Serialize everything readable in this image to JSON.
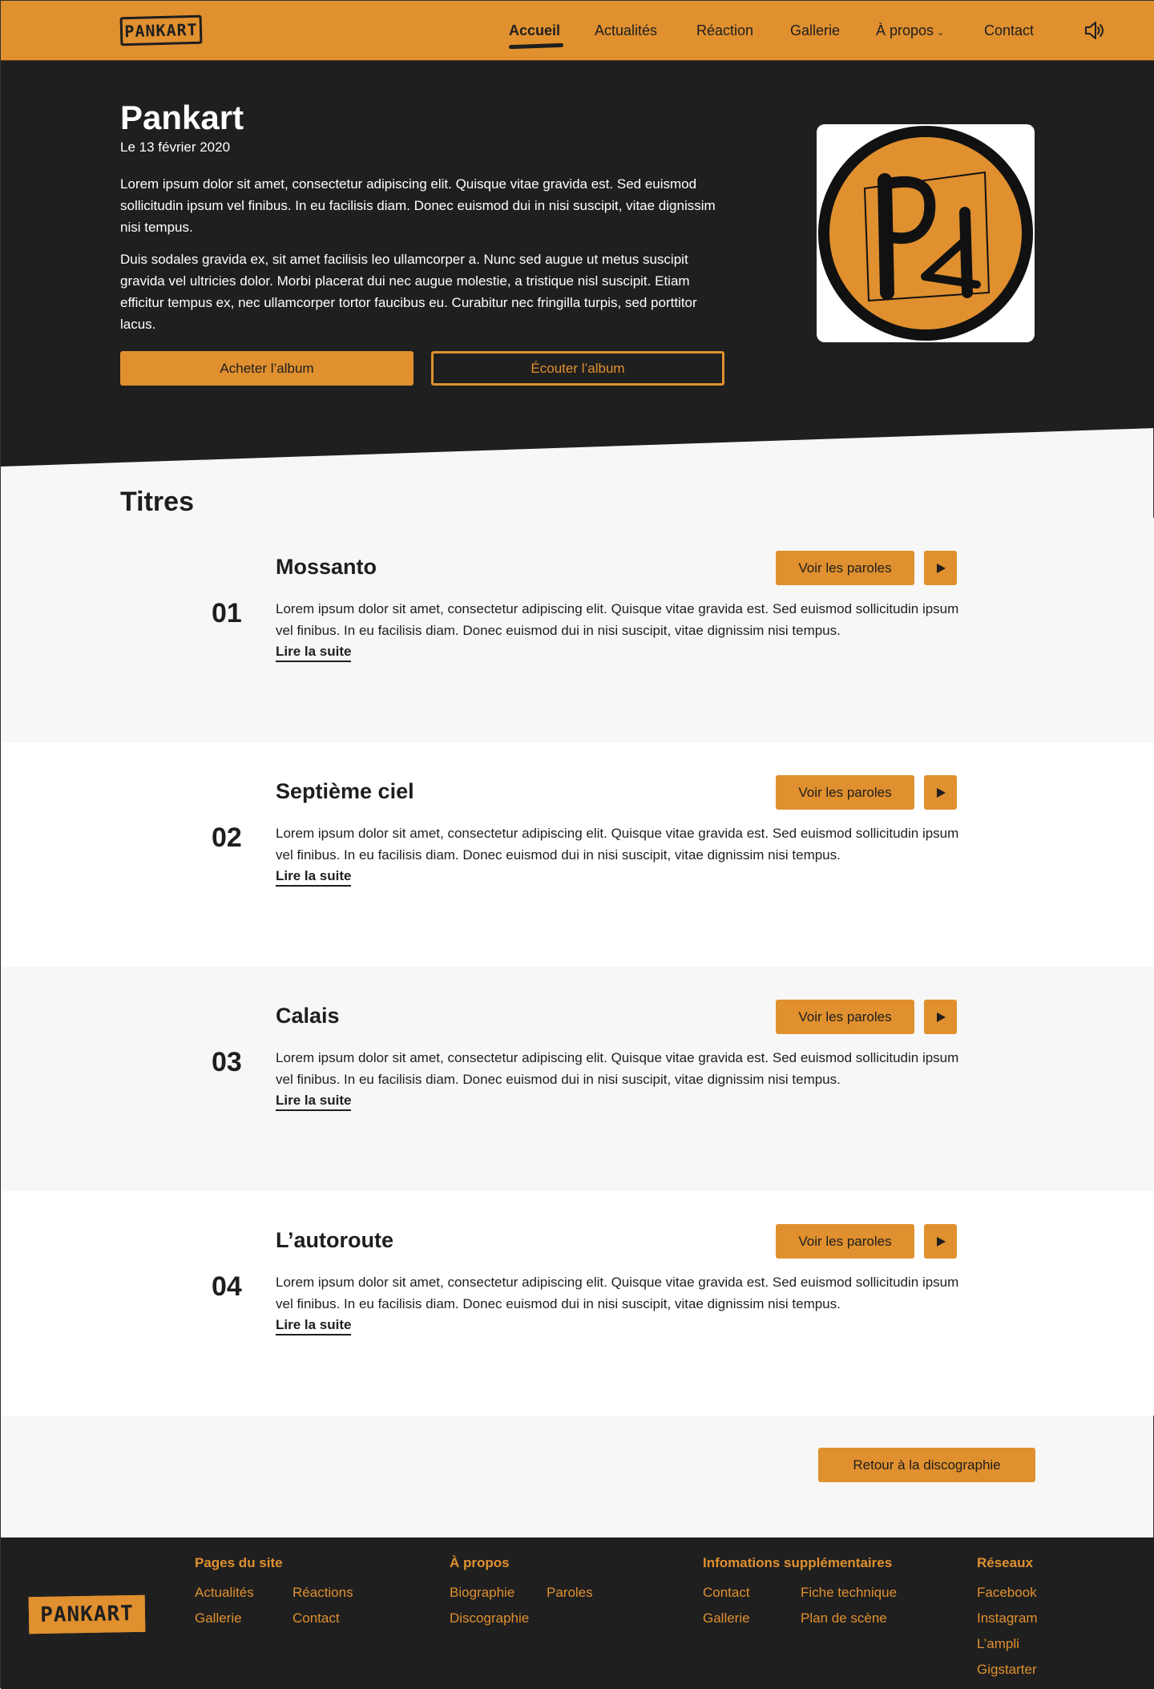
{
  "colors": {
    "accent": "#e0902f",
    "dark": "#1f1f1f",
    "light_grey": "#f7f7f7",
    "white": "#ffffff"
  },
  "header": {
    "logo_text": "PANKART",
    "nav": [
      {
        "label": "Accueil",
        "active": true
      },
      {
        "label": "Actualités",
        "active": false
      },
      {
        "label": "Réaction",
        "active": false
      },
      {
        "label": "Gallerie",
        "active": false
      },
      {
        "label": "À propos",
        "active": false,
        "icon": "chevron-down-icon"
      },
      {
        "label": "Contact",
        "active": false
      }
    ],
    "sound_icon": "speaker-icon"
  },
  "hero": {
    "title": "Pankart",
    "date": "Le 13 février 2020",
    "paragraph1": "Lorem ipsum dolor sit amet, consectetur adipiscing elit. Quisque vitae gravida est. Sed euismod sollicitudin ipsum vel finibus. In eu facilisis diam. Donec euismod dui in nisi suscipit, vitae dignissim nisi tempus.",
    "paragraph2": "Duis sodales gravida ex, sit amet facilisis leo ullamcorper a. Nunc sed augue ut metus suscipit gravida vel ultricies dolor. Morbi placerat dui nec augue molestie, a tristique nisl suscipit. Etiam efficitur tempus ex, nec ullamcorper tortor faucibus eu. Curabitur nec fringilla turpis, sed porttitor lacus.",
    "buy_label": "Acheter l’album",
    "listen_label": "Écouter l’album",
    "album_art_text": "PK"
  },
  "titles": {
    "heading": "Titres",
    "lyrics_label": "Voir les paroles",
    "read_more_label": "Lire la suite",
    "play_icon": "play-icon",
    "tracks": [
      {
        "number": "01",
        "name": "Mossanto",
        "desc": "Lorem ipsum dolor sit amet, consectetur adipiscing elit. Quisque vitae gravida est. Sed euismod sollicitudin ipsum vel finibus. In eu facilisis diam. Donec euismod dui in nisi suscipit, vitae dignissim nisi tempus."
      },
      {
        "number": "02",
        "name": "Septième ciel",
        "desc": "Lorem ipsum dolor sit amet, consectetur adipiscing elit. Quisque vitae gravida est. Sed euismod sollicitudin ipsum vel finibus. In eu facilisis diam. Donec euismod dui in nisi suscipit, vitae dignissim nisi tempus."
      },
      {
        "number": "03",
        "name": "Calais",
        "desc": "Lorem ipsum dolor sit amet, consectetur adipiscing elit. Quisque vitae gravida est. Sed euismod sollicitudin ipsum vel finibus. In eu facilisis diam. Donec euismod dui in nisi suscipit, vitae dignissim nisi tempus."
      },
      {
        "number": "04",
        "name": "L’autoroute",
        "desc": "Lorem ipsum dolor sit amet, consectetur adipiscing elit. Quisque vitae gravida est. Sed euismod sollicitudin ipsum vel finibus. In eu facilisis diam. Donec euismod dui in nisi suscipit, vitae dignissim nisi tempus."
      }
    ],
    "back_label": "Retour à la discographie"
  },
  "footer": {
    "logo_text": "PANKART",
    "columns": [
      {
        "heading": "Pages du site",
        "links": [
          "Actualités",
          "Réactions",
          "Gallerie",
          "Contact"
        ]
      },
      {
        "heading": "À propos",
        "links": [
          "Biographie",
          "Paroles",
          "Discographie"
        ]
      },
      {
        "heading": "Infomations supplémentaires",
        "links": [
          "Contact",
          "Fiche technique",
          "Gallerie",
          "Plan de scène"
        ]
      },
      {
        "heading": "Réseaux",
        "links": [
          "Facebook",
          "Instagram",
          "L’ampli",
          "Gigstarter"
        ]
      }
    ]
  }
}
